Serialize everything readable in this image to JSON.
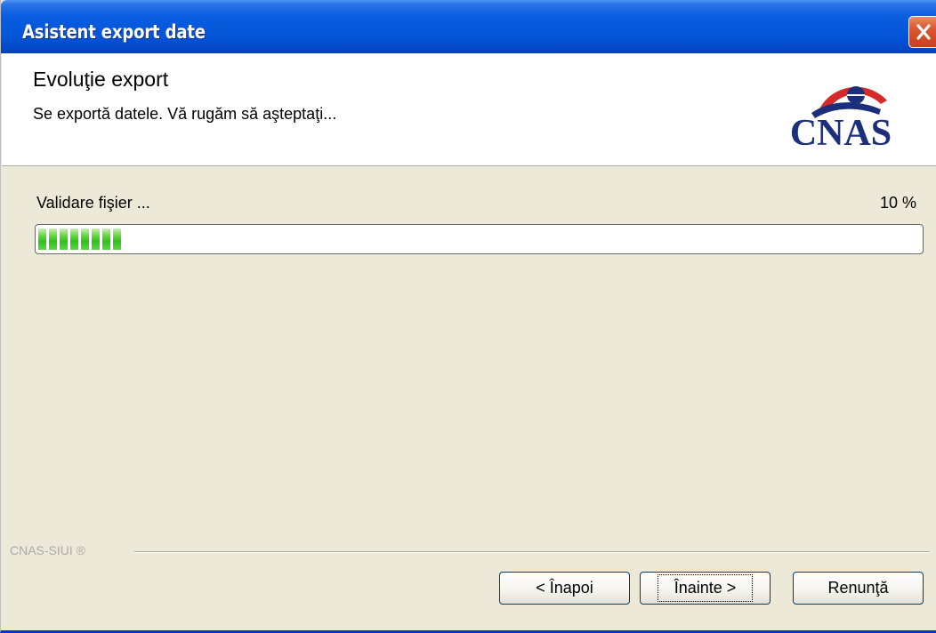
{
  "window": {
    "title": "Asistent export date"
  },
  "header": {
    "title": "Evoluţie export",
    "subtitle": "Se exportă datele. Vă rugăm să aşteptaţi...",
    "logo_text": "CNAS"
  },
  "progress": {
    "label": "Validare fişier ...",
    "percent_text": "10 %",
    "value": 0.1
  },
  "footer": {
    "brand": "CNAS-SIUI ®"
  },
  "buttons": {
    "back": "< Înapoi",
    "next": "Înainte >",
    "cancel": "Renunţă"
  },
  "colors": {
    "titlebar": "#0454d8",
    "progress_fill": "#2ec11a",
    "logo": "#1b2f7a",
    "logo_accent": "#d42a2a"
  },
  "icons": {
    "close": "close-icon",
    "logo": "cnas-logo"
  }
}
